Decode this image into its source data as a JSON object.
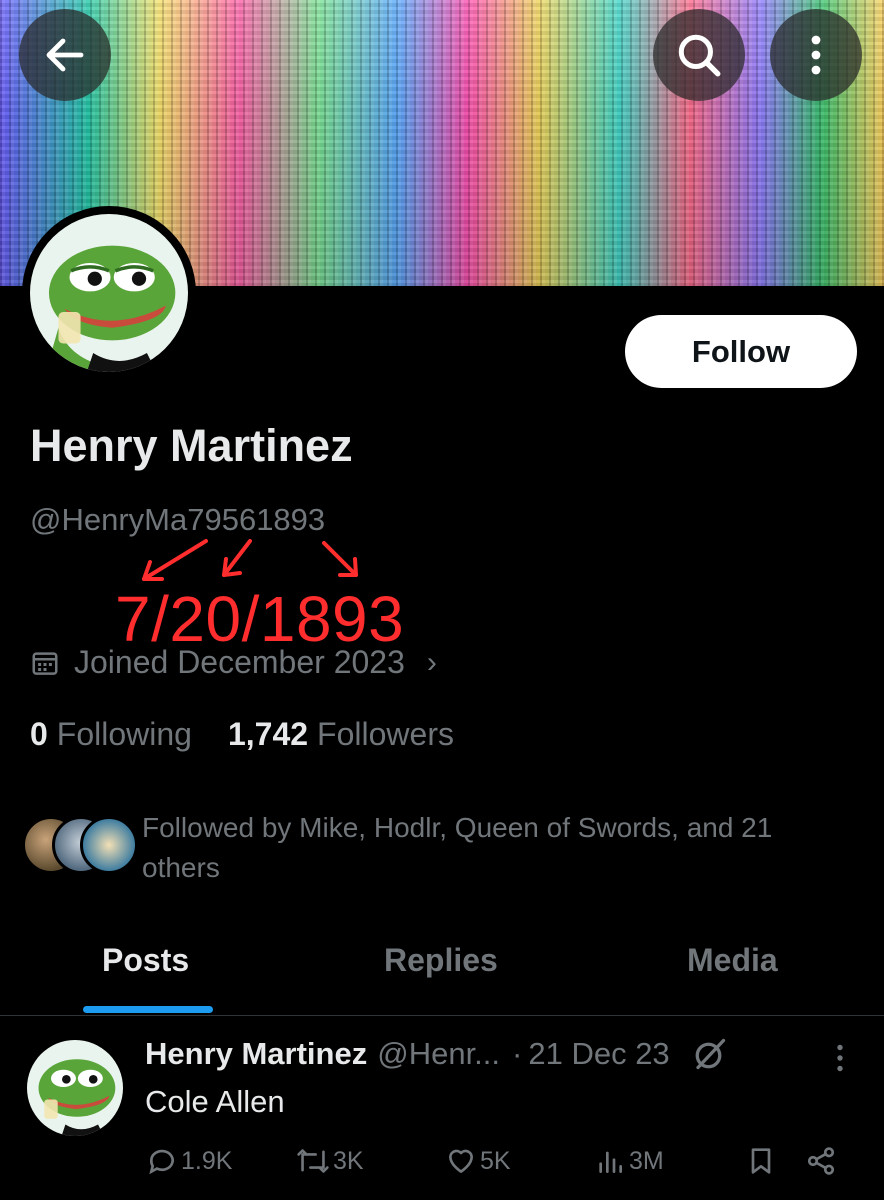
{
  "header": {
    "back_icon": "arrow-left-icon",
    "search_icon": "search-icon",
    "more_icon": "more-vertical-icon"
  },
  "profile": {
    "display_name": "Henry Martinez",
    "handle": "@HenryMa79561893",
    "follow_label": "Follow",
    "joined": "Joined December 2023",
    "following_count": "0",
    "following_label": "Following",
    "followers_count": "1,742",
    "followers_label": "Followers",
    "followed_by": "Followed by Mike, Hodlr, Queen of Swords, and 21 others"
  },
  "annotation": {
    "text": "7/20/1893",
    "color": "#ff2d2d"
  },
  "tabs": [
    {
      "label": "Posts",
      "active": true
    },
    {
      "label": "Replies",
      "active": false
    },
    {
      "label": "Media",
      "active": false
    }
  ],
  "post": {
    "name": "Henry Martinez",
    "handle": "@Henr...",
    "separator": "·",
    "date": "21 Dec 23",
    "text": "Cole Allen",
    "replies": "1.9K",
    "reposts": "3K",
    "likes": "5K",
    "views": "3M"
  },
  "colors": {
    "accent": "#1d9bf0",
    "background": "#000000",
    "muted_text": "#71767b",
    "primary_text": "#e7e9ea"
  }
}
